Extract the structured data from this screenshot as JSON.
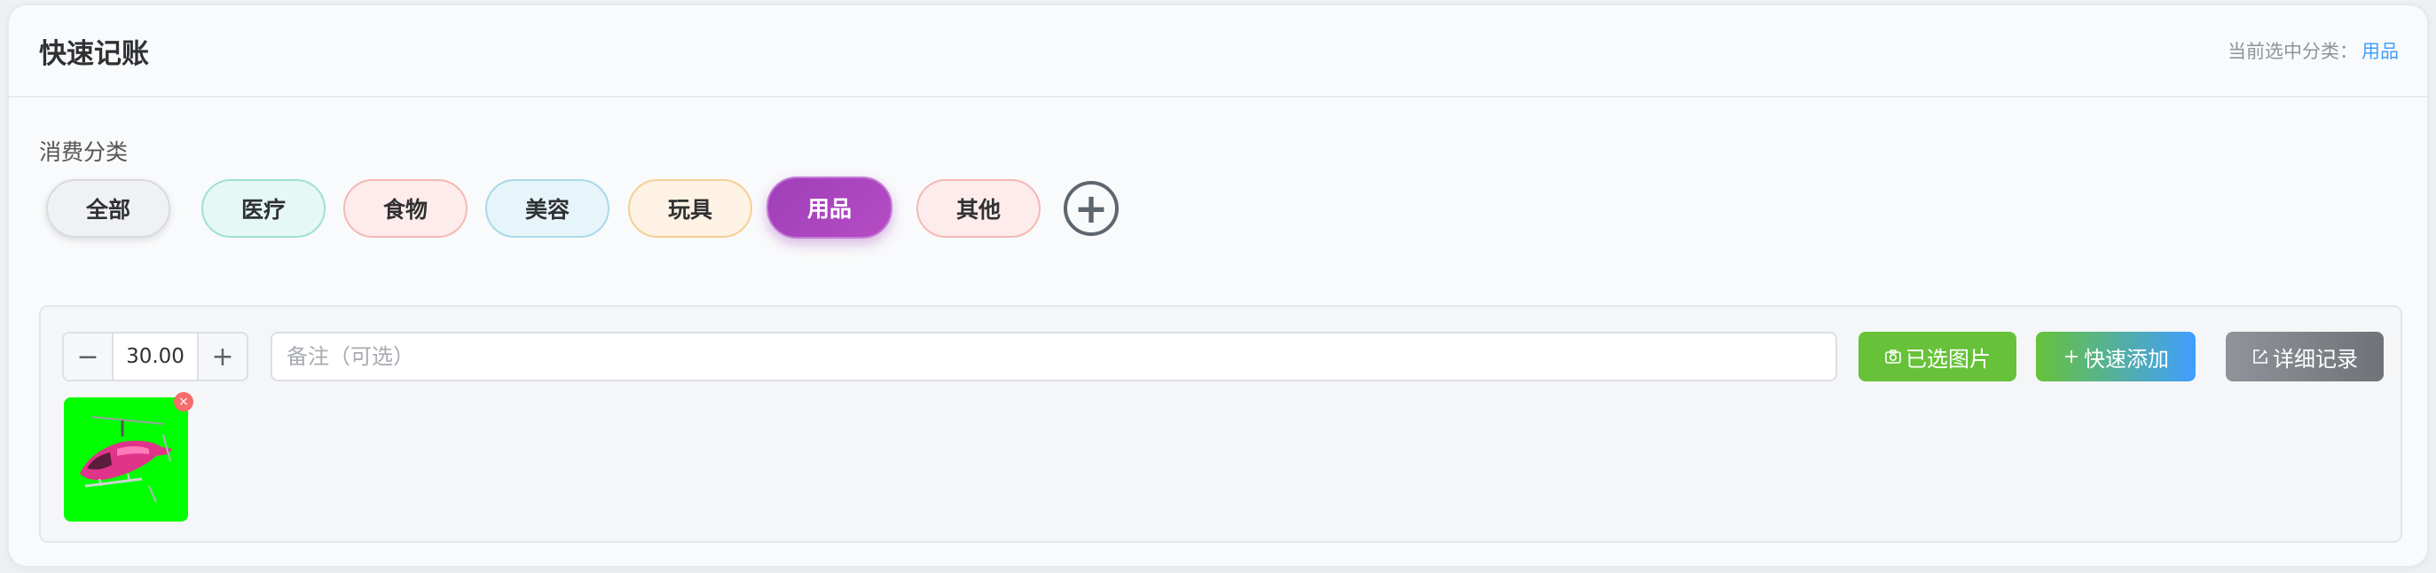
{
  "header": {
    "title": "快速记账",
    "current_label": "当前选中分类：",
    "current_value": "用品"
  },
  "categories": {
    "label": "消费分类",
    "items": [
      {
        "label": "全部"
      },
      {
        "label": "医疗"
      },
      {
        "label": "食物"
      },
      {
        "label": "美容"
      },
      {
        "label": "玩具"
      },
      {
        "label": "用品",
        "selected": true
      },
      {
        "label": "其他"
      }
    ],
    "add_icon": "plus-circle-icon"
  },
  "entry": {
    "amount": "30.00",
    "note_placeholder": "备注（可选）",
    "photo_button": "已选图片",
    "quick_add_button": "快速添加",
    "detail_button": "详细记录",
    "selected_image": "helicopter-photo"
  },
  "colors": {
    "selected_chip": "#9e3fb8",
    "success": "#67c23a",
    "primary": "#409eff",
    "info": "#909399"
  }
}
